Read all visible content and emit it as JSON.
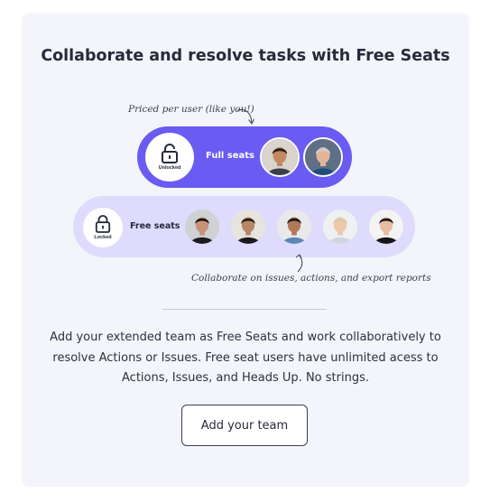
{
  "title": "Collaborate and resolve tasks with Free Seats",
  "notes": {
    "priced": "Priced per user (like you!)",
    "collaborate": "Collaborate on issues, actions, and export reports"
  },
  "full_seats": {
    "lock_label": "Unlocked",
    "label": "Full seats",
    "avatars": [
      {
        "icon": "man-beard-avatar",
        "skin": "#c28a63",
        "hair": "#2a1d16",
        "shirt": "#3a3f4a",
        "bg": "#d9d4cc"
      },
      {
        "icon": "worker-helmet-avatar",
        "skin": "#e2b49a",
        "hair": "#c9cdd3",
        "shirt": "#1f4e7a",
        "bg": "#5e6f86"
      }
    ]
  },
  "free_seats": {
    "lock_label": "Locked",
    "label": "Free seats",
    "avatars": [
      {
        "icon": "woman-dark-hair-avatar",
        "skin": "#c79276",
        "hair": "#1d1512",
        "shirt": "#1b1b1f",
        "bg": "#cfd1d4"
      },
      {
        "icon": "man-smiling-avatar",
        "skin": "#b98766",
        "hair": "#2a1f1a",
        "shirt": "#1a1a1d",
        "bg": "#e7e4df"
      },
      {
        "icon": "man-glasses-avatar",
        "skin": "#b07a5a",
        "hair": "#1b1615",
        "shirt": "#5c86b5",
        "bg": "#e9e9ec"
      },
      {
        "icon": "older-woman-avatar",
        "skin": "#efc7ad",
        "hair": "#d8c8a8",
        "shirt": "#cfd6de",
        "bg": "#eef0f2"
      },
      {
        "icon": "woman-hair-bun-avatar",
        "skin": "#e6bca3",
        "hair": "#1e1a18",
        "shirt": "#151518",
        "bg": "#f3f3f4"
      }
    ]
  },
  "description": "Add your extended team as Free Seats and work collaboratively to resolve Actions or Issues. Free seat users have unlimited acess to Actions, Issues, and Heads Up. No strings.",
  "cta_label": "Add your team",
  "colors": {
    "accent": "#6a5bf2",
    "accent_light": "#dedbfc",
    "card_bg": "#f4f4fb",
    "text": "#262b3a"
  }
}
